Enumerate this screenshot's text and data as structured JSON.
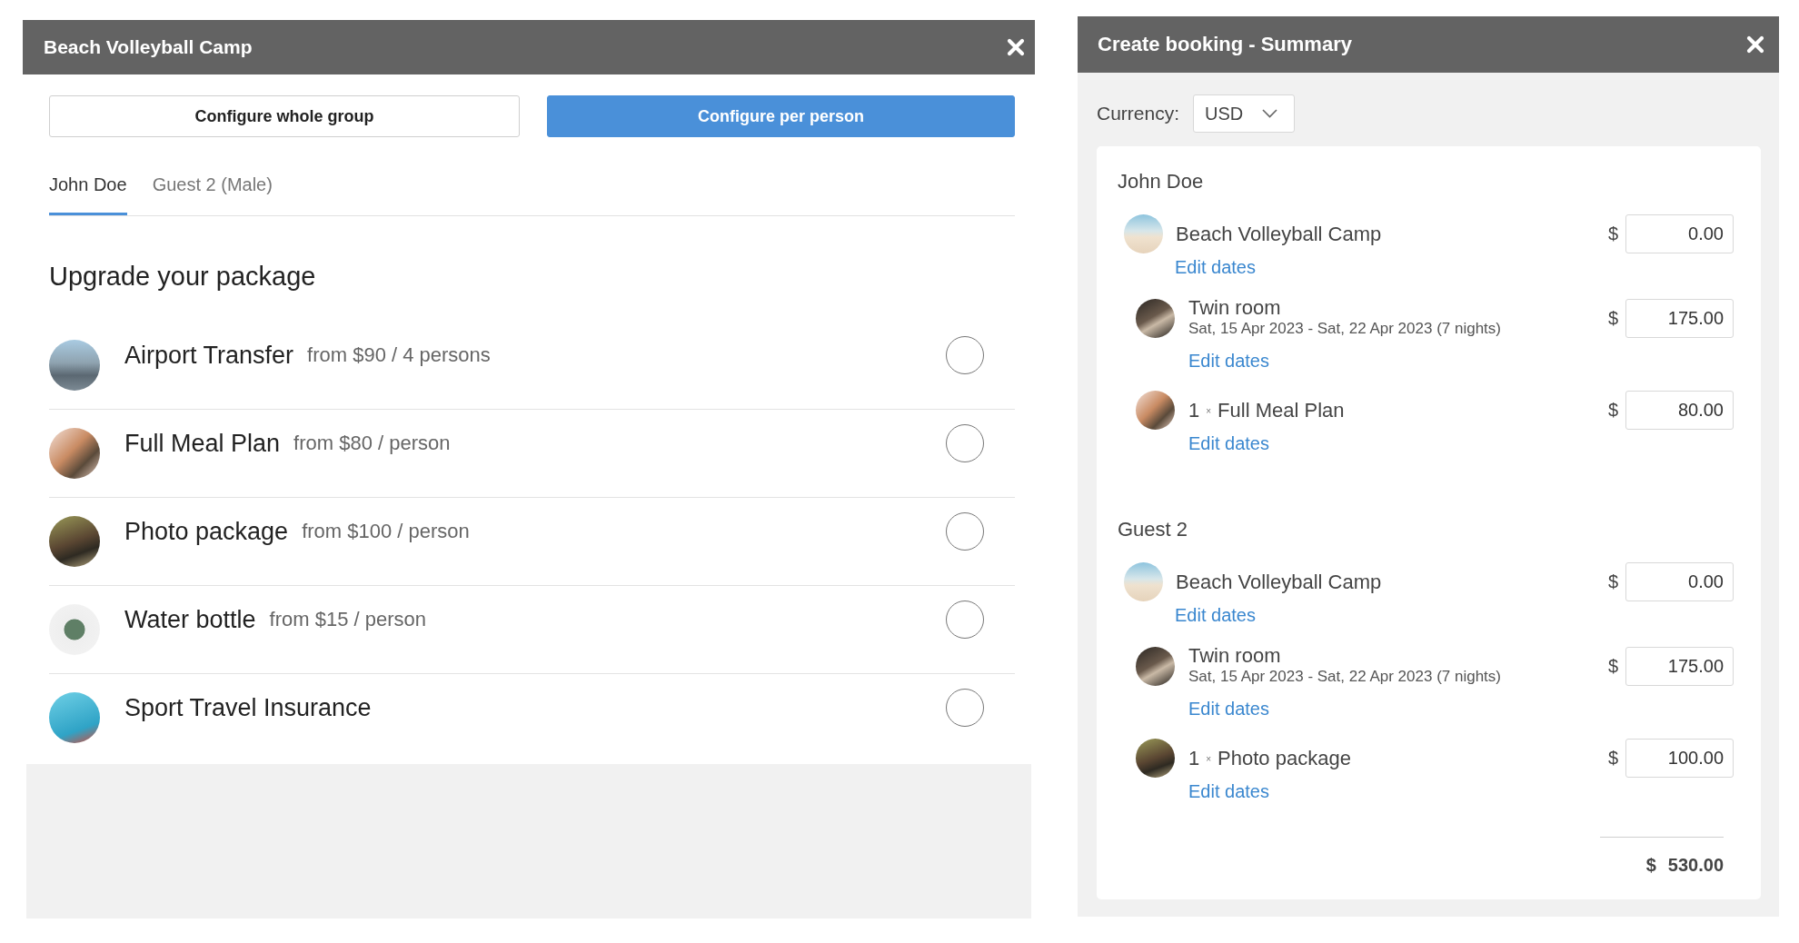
{
  "booking_panel": {
    "title": "Beach Volleyball Camp",
    "mode_buttons": [
      {
        "label": "Configure whole group",
        "selected": false
      },
      {
        "label": "Configure per person",
        "selected": true
      }
    ],
    "tabs": [
      {
        "label": "John Doe",
        "selected": true
      },
      {
        "label": "Guest 2 (Male)",
        "selected": false
      }
    ],
    "section_title": "Upgrade your package",
    "packages": [
      {
        "name": "Airport Transfer",
        "price": "from $90 / 4 persons",
        "selected": false
      },
      {
        "name": "Full Meal Plan",
        "price": "from $80 / person",
        "selected": false
      },
      {
        "name": "Photo package",
        "price": "from $100 / person",
        "selected": false
      },
      {
        "name": "Water bottle",
        "price": "from $15 / person",
        "selected": false
      },
      {
        "name": "Sport Travel Insurance",
        "selected": false
      }
    ]
  },
  "summary_panel": {
    "title": "Create booking - Summary",
    "currency_label": "Currency:",
    "currency_select": {
      "value": "USD"
    },
    "guests": [
      {
        "name": "John Doe",
        "items": [
          {
            "kind": "activity",
            "name": "Beach Volleyball Camp",
            "link": "Edit dates",
            "currency": "$",
            "price": "0.00"
          },
          {
            "kind": "room",
            "name": "Twin room",
            "dates": "Sat, 15 Apr 2023 - Sat, 22 Apr 2023 (7 nights)",
            "link": "Edit dates",
            "currency": "$",
            "price": "175.00"
          },
          {
            "kind": "extra",
            "quantity": "1",
            "times": "×",
            "name": "Full Meal Plan",
            "link": "Edit dates",
            "currency": "$",
            "price": "80.00"
          }
        ]
      },
      {
        "name": "Guest 2",
        "items": [
          {
            "kind": "activity",
            "name": "Beach Volleyball Camp",
            "link": "Edit dates",
            "currency": "$",
            "price": "0.00"
          },
          {
            "kind": "room",
            "name": "Twin room",
            "dates": "Sat, 15 Apr 2023 - Sat, 22 Apr 2023 (7 nights)",
            "link": "Edit dates",
            "currency": "$",
            "price": "175.00"
          },
          {
            "kind": "extra",
            "quantity": "1",
            "times": "×",
            "name": "Photo package",
            "link": "Edit dates",
            "currency": "$",
            "price": "100.00"
          }
        ]
      }
    ],
    "total": {
      "currency": "$",
      "amount": "530.00"
    }
  }
}
